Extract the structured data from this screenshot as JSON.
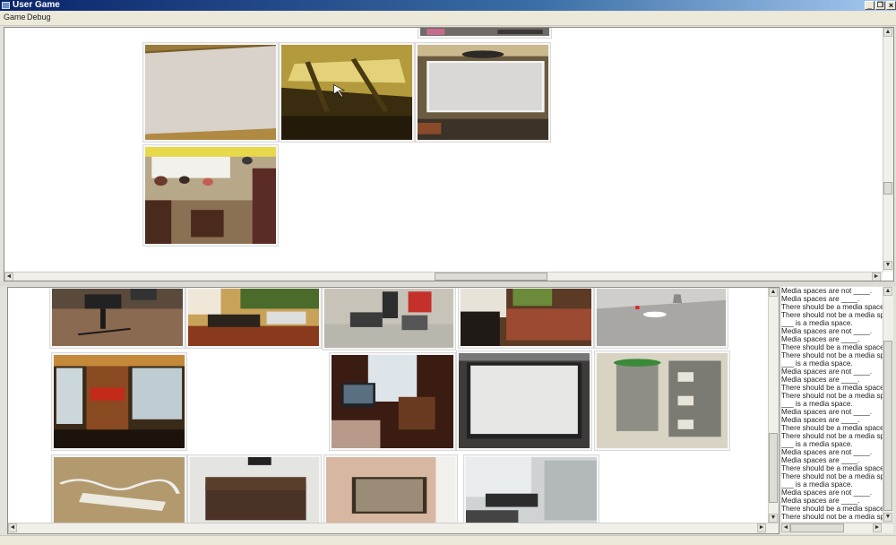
{
  "window": {
    "title": "User Game",
    "minimize_glyph": "_",
    "restore_glyph": "❐",
    "close_glyph": "×"
  },
  "menu": {
    "items": [
      "Game",
      "Debug"
    ]
  },
  "top_gallery": {
    "label": "top image gallery",
    "vertical_scroll_position": 0.45,
    "horizontal_scroll_position": 0.5
  },
  "bottom_gallery": {
    "label": "bottom image gallery",
    "vertical_scroll_position": 0.9
  },
  "scroll_glyphs": {
    "up": "▲",
    "down": "▼",
    "left": "◄",
    "right": "►"
  },
  "prompt_log": {
    "lines": [
      "Media spaces are not ____.",
      "Media spaces are ____.",
      "There should be a media space",
      "There should not be a media space",
      "___ is a media space.",
      "Media spaces are not ____.",
      "Media spaces are ____.",
      "There should be a media space",
      "There should not be a media space",
      "___ is a media space.",
      "Media spaces are not ____.",
      "Media spaces are ____.",
      "There should be a media space",
      "There should not be a media space",
      "___ is a media space.",
      "Media spaces are not ____.",
      "Media spaces are ____.",
      "There should be a media space",
      "There should not be a media space",
      "___ is a media space.",
      "Media spaces are not ____.",
      "Media spaces are ____.",
      "There should be a media space",
      "There should not be a media space",
      "___ is a media space.",
      "Media spaces are not ____.",
      "Media spaces are ____.",
      "There should be a media space",
      "There should not be a media space"
    ]
  },
  "colors": {
    "title_gradient_start": "#0a246a",
    "title_gradient_end": "#a6caf0",
    "window_chrome": "#ece9d8"
  }
}
